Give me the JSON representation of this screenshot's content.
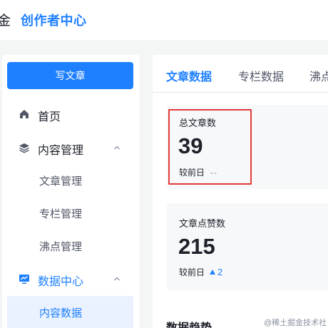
{
  "header": {
    "brand_char": "金",
    "title": "创作者中心"
  },
  "sidebar": {
    "write_button": "写文章",
    "items": [
      {
        "label": "首页",
        "icon": "home-icon"
      },
      {
        "label": "内容管理",
        "icon": "layers-icon",
        "expanded": true,
        "children": [
          "文章管理",
          "专栏管理",
          "沸点管理"
        ]
      },
      {
        "label": "数据中心",
        "icon": "chart-monitor-icon",
        "expanded": true,
        "active": true,
        "children": [
          "内容数据"
        ]
      }
    ]
  },
  "tabs": [
    "文章数据",
    "专栏数据",
    "沸点"
  ],
  "active_tab": "文章数据",
  "cards": [
    {
      "label": "总文章数",
      "value": "39",
      "compare_label": "较前日",
      "compare_value": "--"
    },
    {
      "label": "文章点赞数",
      "value": "215",
      "compare_label": "较前日",
      "compare_value": "2"
    }
  ],
  "section_title": "数据趋势",
  "watermark": "@稀土掘金技术社区",
  "colors": {
    "accent": "#1e80ff",
    "highlight": "#e33a3a"
  }
}
